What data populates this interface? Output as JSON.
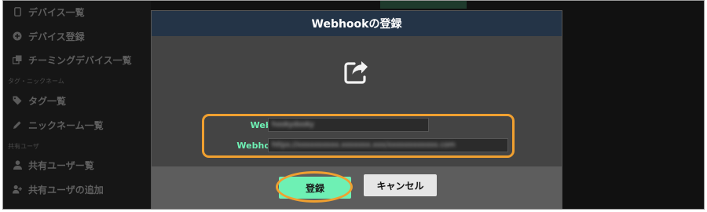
{
  "sidebar": {
    "items": [
      {
        "label": "デバイス一覧",
        "icon": "phone-icon"
      },
      {
        "label": "デバイス登録",
        "icon": "plus-circle-icon"
      },
      {
        "label": "チーミングデバイス一覧",
        "icon": "clone-icon"
      },
      {
        "label": "タグ一覧",
        "icon": "tag-icon"
      },
      {
        "label": "ニックネーム一覧",
        "icon": "pencil-icon"
      },
      {
        "label": "共有ユーザー覧",
        "icon": "user-icon"
      },
      {
        "label": "共有ユーザの追加",
        "icon": "user-plus-icon"
      }
    ],
    "sections": {
      "tag_nickname": "タグ・ニックネーム",
      "shared_user": "共有ユーザ"
    }
  },
  "modal": {
    "title": "Webhookの登録",
    "icon": "share-square-icon",
    "form": {
      "name_label": "Webhook名",
      "name_value": "hookydooky",
      "url_label": "Webhook URL",
      "url_value": "https://xxxxxxxxxx.xxxxxxx.xxx/xxxxxxxxxxxx.com"
    },
    "register_button": "登録",
    "cancel_button": "キャンセル"
  },
  "colors": {
    "accent_green": "#6ef0b4",
    "highlight_orange": "#f0a030",
    "header_blue": "#243447"
  }
}
